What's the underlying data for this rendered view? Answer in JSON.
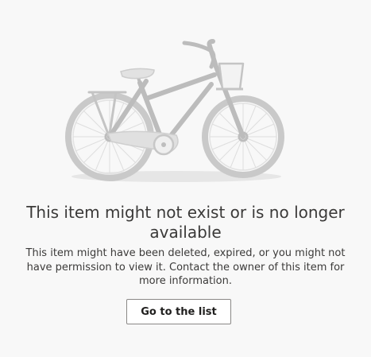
{
  "error": {
    "title": "This item might not exist or is no longer available",
    "description": "This item might have been deleted, expired, or you might not have permission to view it. Contact the owner of this item for more information.",
    "button_label": "Go to the list"
  },
  "illustration": {
    "icon": "bicycle-icon",
    "frame_color": "#bdbdbd",
    "wheel_color": "#c8c8c8",
    "shadow_color": "#e6e6e6"
  }
}
